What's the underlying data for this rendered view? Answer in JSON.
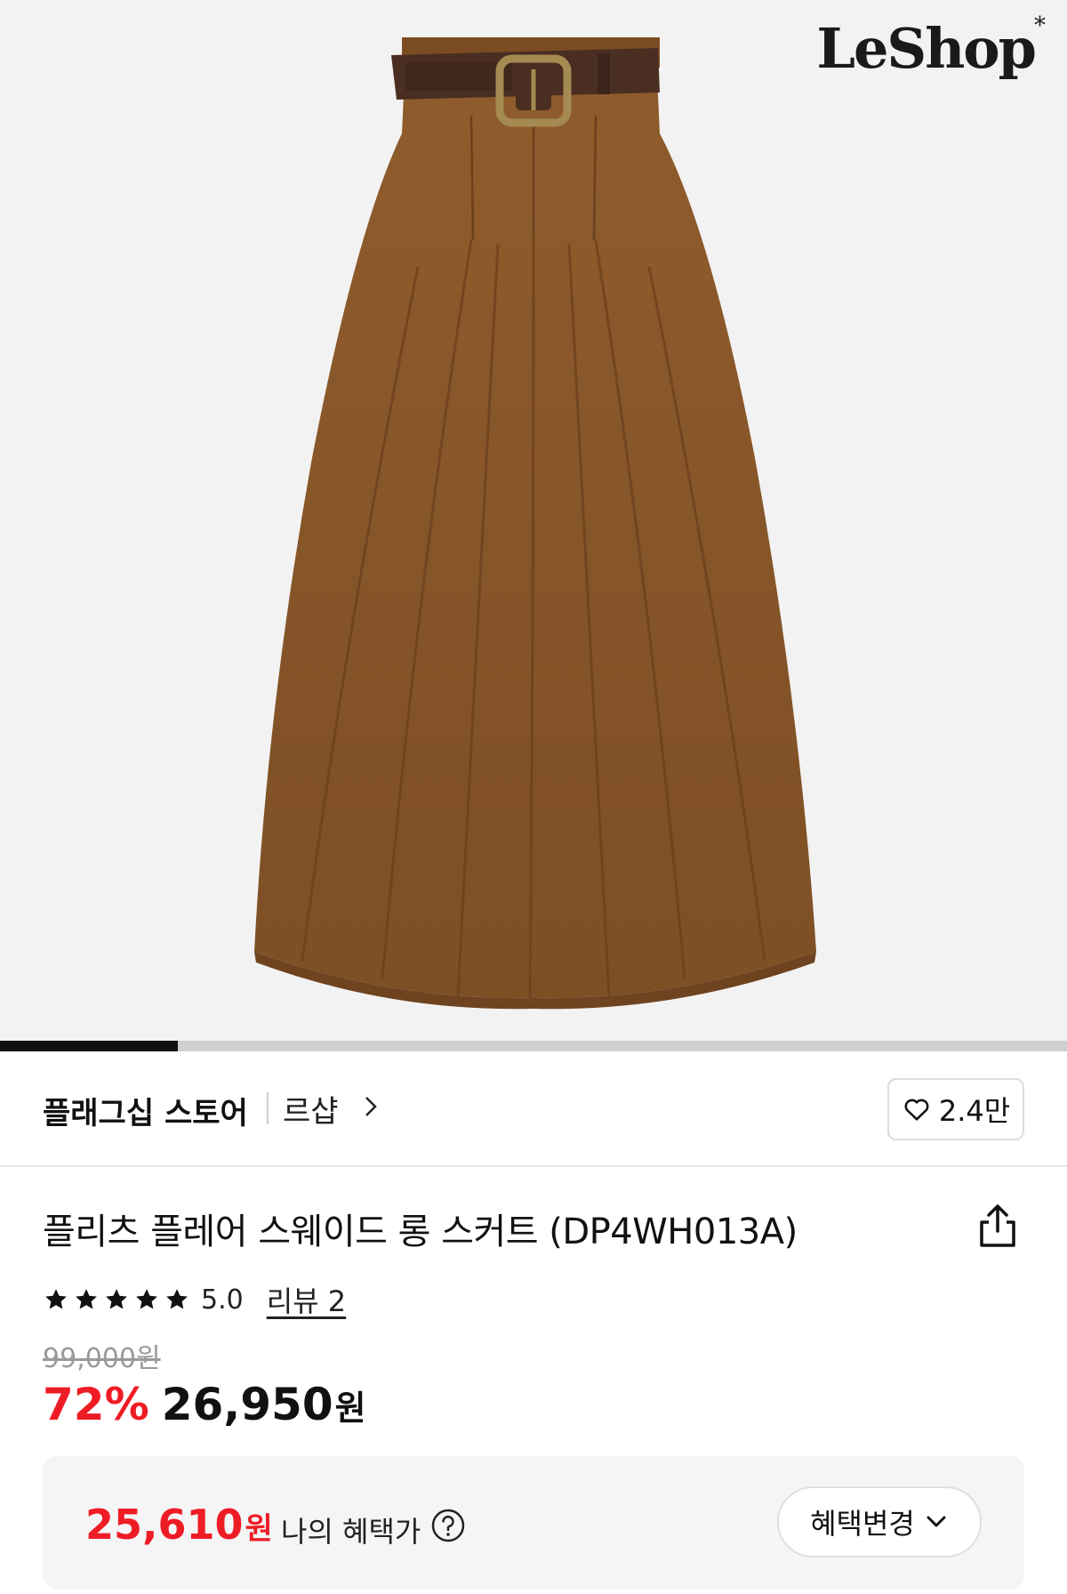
{
  "hero": {
    "logo": "LeShop",
    "logo_mark": "*",
    "product_image": "brown-pleated-skirt-with-belt"
  },
  "gallery": {
    "progress_fraction": 0.167
  },
  "store": {
    "tag": "플래그십 스토어",
    "name": "르샵",
    "like_count": "2.4만"
  },
  "product": {
    "title": "플리츠 플레어 스웨이드 롱 스커트 (DP4WH013A)",
    "rating_stars": 5,
    "rating_score": "5.0",
    "review_link": "리뷰 2",
    "original_price": "99,000원",
    "discount": "72%",
    "price": "26,950",
    "price_unit": "원"
  },
  "benefit": {
    "price": "25,610",
    "price_unit": "원",
    "label": "나의 혜택가",
    "change_button": "혜택변경"
  },
  "colors": {
    "accent_red": "#ee1c25",
    "skirt_brown": "#8b5a2b",
    "belt_brown": "#4a2e22"
  },
  "icons": [
    "chevron-right-icon",
    "heart-icon",
    "share-icon",
    "star-icon",
    "help-icon",
    "chevron-down-icon"
  ]
}
